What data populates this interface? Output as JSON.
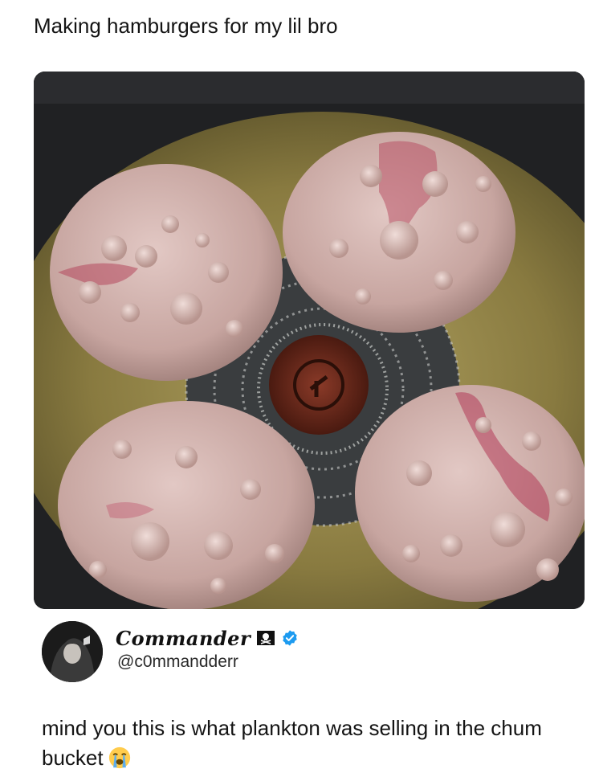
{
  "post": {
    "caption": "Making hamburgers for my lil bro"
  },
  "tweet": {
    "display_name": "Commander",
    "handle": "@c0mmandderr",
    "text": "mind you this is what plankton was selling in the chum bucket",
    "emoji_icon": "loudly-crying-face-icon",
    "flag_icon": "pirate-flag-icon",
    "verified_icon": "verified-badge-icon",
    "verified_color": "#1d9bf0"
  },
  "colors": {
    "background": "#ffffff",
    "text": "#141414",
    "pan": "#1f2022",
    "patty": "#c9a9a6",
    "grease": "#a89a55"
  }
}
